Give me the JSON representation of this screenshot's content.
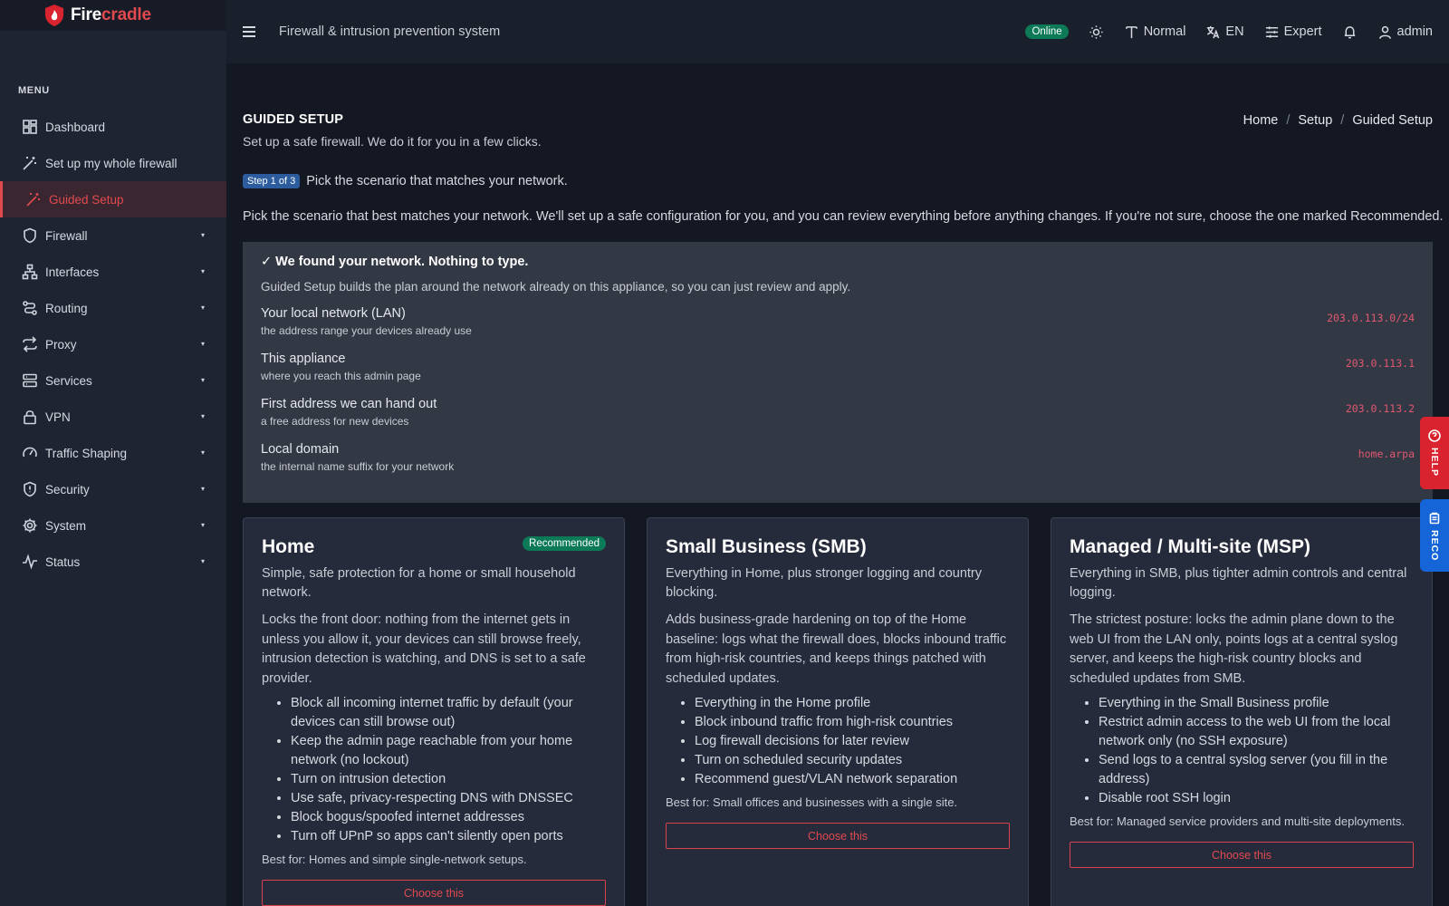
{
  "brand": {
    "name_prefix": "Fire",
    "name_suffix": "cradle"
  },
  "sidebar": {
    "menu_label": "MENU",
    "items": [
      {
        "label": "Dashboard",
        "icon": "dashboard-icon"
      },
      {
        "label": "Set up my whole firewall",
        "icon": "magic-wand-icon"
      },
      {
        "label": "Guided Setup",
        "icon": "magic-wand-icon",
        "active": true
      },
      {
        "label": "Firewall",
        "icon": "shield-icon",
        "caret": "▾"
      },
      {
        "label": "Interfaces",
        "icon": "network-icon",
        "caret": "▾"
      },
      {
        "label": "Routing",
        "icon": "route-icon",
        "caret": "▾"
      },
      {
        "label": "Proxy",
        "icon": "arrows-swap-icon",
        "caret": "▾"
      },
      {
        "label": "Services",
        "icon": "server-icon",
        "caret": "▾"
      },
      {
        "label": "VPN",
        "icon": "lock-icon",
        "caret": "▾"
      },
      {
        "label": "Traffic Shaping",
        "icon": "gauge-icon",
        "caret": "▾"
      },
      {
        "label": "Security",
        "icon": "shield-alert-icon",
        "caret": "▾"
      },
      {
        "label": "System",
        "icon": "gear-icon",
        "caret": "▾"
      },
      {
        "label": "Status",
        "icon": "pulse-icon",
        "caret": "▾"
      }
    ]
  },
  "topbar": {
    "title": "Firewall & intrusion prevention system",
    "status": "Online",
    "font_size": "Normal",
    "language": "EN",
    "mode": "Expert",
    "user": "admin"
  },
  "page": {
    "title": "GUIDED SETUP",
    "subtitle": "Set up a safe firewall. We do it for you in a few clicks.",
    "breadcrumb": [
      "Home",
      "Setup",
      "Guided Setup"
    ],
    "breadcrumb_sep": "/",
    "step_badge": "Step 1 of 3",
    "step_text": "Pick the scenario that matches your network.",
    "intro": "Pick the scenario that best matches your network. We'll set up a safe configuration for you, and you can review everything before anything changes. If you're not sure, choose the one marked Recommended."
  },
  "found": {
    "title": "✓ We found your network. Nothing to type.",
    "description": "Guided Setup builds the plan around the network already on this appliance, so you can just review and apply.",
    "rows": [
      {
        "label": "Your local network (LAN)",
        "hint": "the address range your devices already use",
        "value": "203.0.113.0/24"
      },
      {
        "label": "This appliance",
        "hint": "where you reach this admin page",
        "value": "203.0.113.1"
      },
      {
        "label": "First address we can hand out",
        "hint": "a free address for new devices",
        "value": "203.0.113.2"
      },
      {
        "label": "Local domain",
        "hint": "the internal name suffix for your network",
        "value": "home.arpa"
      }
    ]
  },
  "cards": [
    {
      "title": "Home",
      "badge": "Recommended",
      "subtitle": "Simple, safe protection for a home or small household network.",
      "description": "Locks the front door: nothing from the internet gets in unless you allow it, your devices can still browse freely, intrusion detection is watching, and DNS is set to a safe provider.",
      "bullets": [
        "Block all incoming internet traffic by default (your devices can still browse out)",
        "Keep the admin page reachable from your home network (no lockout)",
        "Turn on intrusion detection",
        "Use safe, privacy-respecting DNS with DNSSEC",
        "Block bogus/spoofed internet addresses",
        "Turn off UPnP so apps can't silently open ports"
      ],
      "best_for": "Best for: Homes and simple single-network setups.",
      "button": "Choose this"
    },
    {
      "title": "Small Business (SMB)",
      "badge": "",
      "subtitle": "Everything in Home, plus stronger logging and country blocking.",
      "description": "Adds business-grade hardening on top of the Home baseline: logs what the firewall does, blocks inbound traffic from high-risk countries, and keeps things patched with scheduled updates.",
      "bullets": [
        "Everything in the Home profile",
        "Block inbound traffic from high-risk countries",
        "Log firewall decisions for later review",
        "Turn on scheduled security updates",
        "Recommend guest/VLAN network separation"
      ],
      "best_for": "Best for: Small offices and businesses with a single site.",
      "button": "Choose this"
    },
    {
      "title": "Managed / Multi-site (MSP)",
      "badge": "",
      "subtitle": "Everything in SMB, plus tighter admin controls and central logging.",
      "description": "The strictest posture: locks the admin plane down to the web UI from the LAN only, points logs at a central syslog server, and keeps the high-risk country blocks and scheduled updates from SMB.",
      "bullets": [
        "Everything in the Small Business profile",
        "Restrict admin access to the web UI from the local network only (no SSH exposure)",
        "Send logs to a central syslog server (you fill in the address)",
        "Disable root SSH login"
      ],
      "best_for": "Best for: Managed service providers and multi-site deployments.",
      "button": "Choose this"
    }
  ],
  "side_tabs": {
    "help": "HELP",
    "reco": "RECO"
  },
  "colors": {
    "accent": "#e04a4f",
    "online": "#0c7a57",
    "step_badge": "#2d5c9e",
    "help_tab": "#d9242f",
    "reco_tab": "#1565d8"
  }
}
